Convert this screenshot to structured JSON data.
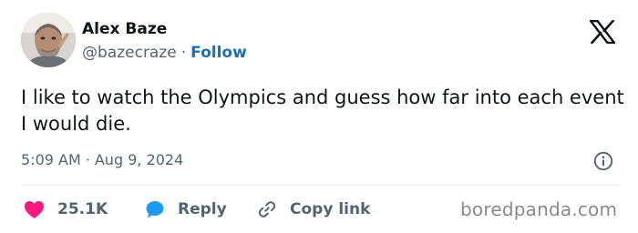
{
  "author": {
    "name": "Alex Baze",
    "handle": "@bazecraze",
    "separator": "·",
    "follow_label": "Follow"
  },
  "tweet": {
    "text": "I like to watch the Olympics and guess how far into each event I would die.",
    "time": "5:09 AM",
    "separator": "·",
    "date": "Aug 9, 2024"
  },
  "actions": {
    "likes_count": "25.1K",
    "reply_label": "Reply",
    "copy_label": "Copy link"
  },
  "watermark": "boredpanda.com",
  "icons": {
    "brand": "x-logo-icon",
    "info": "info-icon",
    "like": "heart-icon",
    "reply": "reply-bubble-icon",
    "copy": "link-icon"
  },
  "colors": {
    "name": "#0f1419",
    "secondary": "#536471",
    "follow": "#1d6fb8",
    "heart": "#f91880",
    "reply_bubble": "#1d9bf0",
    "watermark": "#8a8a8a"
  }
}
